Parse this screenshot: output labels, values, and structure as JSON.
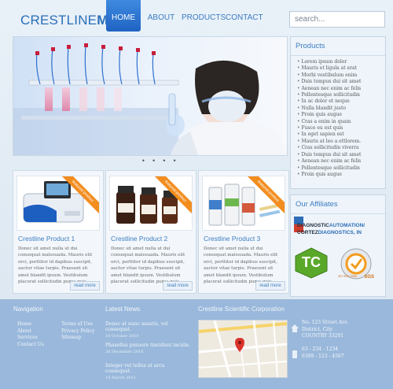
{
  "logo": {
    "part1": "CRESTLINE",
    "part2": "MED"
  },
  "nav": {
    "items": [
      {
        "label": "HOME",
        "active": true
      },
      {
        "label": "ABOUT",
        "active": false
      },
      {
        "label": "PRODUCTS",
        "active": false
      },
      {
        "label": "CONTACT",
        "active": false
      }
    ]
  },
  "search": {
    "placeholder": "search..."
  },
  "slider": {
    "dots": "• • • •"
  },
  "products_panel": {
    "title": "Products",
    "items": [
      "Lorem ipsum dolor",
      "Mauris et ligula at erat",
      "Morbi vestibulum enim",
      "Duis tempus dui sit amet",
      "Aenean nec enim ac felis",
      "Pellentesque sollicitudin",
      "In ac dolor et neque",
      "Nulla blandit justo",
      "Proin quis augue",
      "Cras a enim in quam",
      "Fusce eu est quis",
      "In eget sapien est",
      "Mauris at leo a ettlorem.",
      "Cras sollicitudin viverra",
      "Duis tempus dui sit amet",
      "Aenean nec enim ac felis",
      "Pellentesque sollicitudin",
      "Proin quis augue"
    ]
  },
  "affiliates": {
    "title": "Our Affiliates",
    "diag_line1": "DIAGNOSTIC",
    "diag_line1b": "AUTOMATION/",
    "diag_line2": "CORTEZ",
    "diag_line2b": "DIAGNOSTICS, IN",
    "tc": "TC",
    "sgs": "SGS",
    "iso": "ISO 9001:2008"
  },
  "products": [
    {
      "title": "Crestline Product 1",
      "ribbon": "featured product",
      "text": "Donec sit amet nulla ut dui consequat malesuada. Mauris elit orci, porttitor id dapibus suscipit, auctor vitae turpis. Praesent sit amet blandit ipsum. Vestibulum placerat sollicitudin purus quis",
      "more": "read more"
    },
    {
      "title": "Crestline Product 2",
      "ribbon": "featured product",
      "text": "Donec sit amet nulla ut dui consequat malesuada. Mauris elit orci, porttitor id dapibus suscipit, auctor vitae turpis. Praesent sit amet blandit ipsum. Vestibulum placerat sollicitudin purus quis",
      "more": "read more"
    },
    {
      "title": "Crestline Product 3",
      "ribbon": "featured product",
      "text": "Donec sit amet nulla ut dui consequat malesuada. Mauris elit orci, porttitor id dapibus suscipit, auctor vitae turpis. Praesent sit amet blandit ipsum. Vestibulum placerat sollicitudin purus quis",
      "more": "read more"
    }
  ],
  "footer": {
    "nav_title": "Navigation",
    "nav_col1": [
      "Home",
      "About",
      "Services",
      "Contact Us"
    ],
    "nav_col2": [
      "Terms of Use",
      "Privacy Policy",
      "Sitemap"
    ],
    "news_title": "Latest News",
    "news": [
      {
        "title": "Donec at nunc mauris, vel consequat.",
        "date": "10 October 2010"
      },
      {
        "title": "Phasellus posuere tincidunt iaculis.",
        "date": "28 December 2010"
      },
      {
        "title": "Integer vel tellus at arcu consequat.",
        "date": "19 March 2011"
      }
    ],
    "corp_title": "Crestline Scientific Corporation",
    "address": [
      "No. 123 Street Ave.",
      "District, City",
      "COUNTRY 33201"
    ],
    "phones": [
      "63 - 234 - 1234",
      "6399 - 123 - 4567"
    ]
  },
  "colors": {
    "accent": "#2a6fb8",
    "nav_active": "#1f63c2",
    "ribbon": "#f28d1f",
    "footer": "#99b8db"
  }
}
